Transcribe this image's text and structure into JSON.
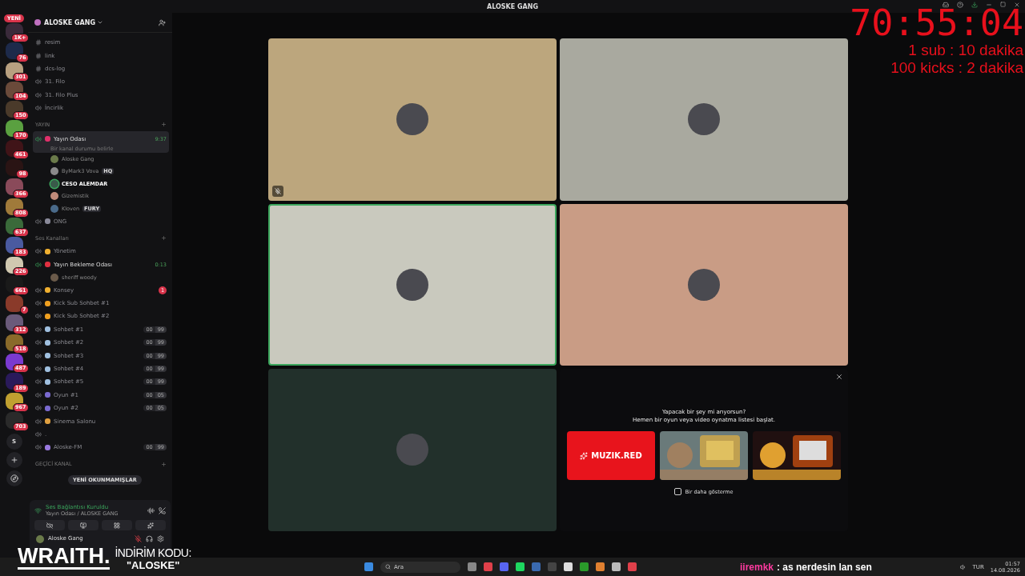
{
  "window": {
    "title": "ALOSKE GANG"
  },
  "servers": {
    "new_label": "YENİ",
    "items": [
      {
        "badge": "1K+",
        "color": "#3a2a3a"
      },
      {
        "badge": "76",
        "color": "#1d2a4a"
      },
      {
        "badge": "301",
        "color": "#b8a080"
      },
      {
        "badge": "104",
        "color": "#6a4a3a"
      },
      {
        "badge": "150",
        "color": "#4a3a2a"
      },
      {
        "badge": "170",
        "color": "#5aa040"
      },
      {
        "badge": "461",
        "color": "#401418"
      },
      {
        "badge": "98",
        "color": "#2a1414"
      },
      {
        "badge": "366",
        "color": "#8a4a5a"
      },
      {
        "badge": "808",
        "color": "#a07a3a"
      },
      {
        "badge": "637",
        "color": "#3a6a3a"
      },
      {
        "badge": "183",
        "color": "#4a5aa0"
      },
      {
        "badge": "226",
        "color": "#d0c8b0"
      },
      {
        "badge": "661",
        "color": "#1a1a1a"
      },
      {
        "badge": "7",
        "color": "#8a3a2a"
      },
      {
        "badge": "312",
        "color": "#6a5a7a"
      },
      {
        "badge": "518",
        "color": "#8a6a2a"
      },
      {
        "badge": "487",
        "color": "#7a3ad0"
      },
      {
        "badge": "189",
        "color": "#2a1a5a"
      },
      {
        "badge": "967",
        "color": "#c0a030"
      },
      {
        "badge": "703",
        "color": "#2a2a2a"
      }
    ],
    "letter": "S"
  },
  "guild": {
    "name": "ALOSKE GANG"
  },
  "channels": [
    {
      "kind": "text",
      "name": "resim"
    },
    {
      "kind": "text",
      "name": "link"
    },
    {
      "kind": "text",
      "name": "dcs-log"
    },
    {
      "kind": "voice",
      "name": "31. Filo"
    },
    {
      "kind": "voice",
      "name": "31. Filo Plus"
    },
    {
      "kind": "voice",
      "name": "İncirlik"
    },
    {
      "kind": "category",
      "name": "YAYIN"
    },
    {
      "kind": "voice",
      "name": "Yayın Odası",
      "color": "#e0306a",
      "connected": true,
      "selected": true,
      "time": "9:37",
      "status": "Bir kanal durumu belirle"
    },
    {
      "kind": "member",
      "name": "Aloske Gang",
      "speaking": false,
      "color": "#6a7a4a"
    },
    {
      "kind": "member",
      "name": "ByMark3 Vova",
      "tag": "HQ",
      "speaking": false,
      "color": "#8a8a8a"
    },
    {
      "kind": "member",
      "name": "CESO ALEMDAR",
      "speaking": true,
      "color": "#3a5a4a"
    },
    {
      "kind": "member",
      "name": "Gizemistik",
      "speaking": false,
      "color": "#c08a7a"
    },
    {
      "kind": "member",
      "name": "Kloven",
      "tag": "FURY",
      "speaking": false,
      "color": "#4a6a8a"
    },
    {
      "kind": "voice",
      "name": "ONG",
      "color": "#8a8a9a"
    },
    {
      "kind": "category",
      "name": "Ses Kanalları"
    },
    {
      "kind": "voice",
      "name": "Yönetim",
      "color": "#f0b030"
    },
    {
      "kind": "voice",
      "name": "Yayın Bekleme Odası",
      "color": "#e03040",
      "connected": true,
      "selected": false,
      "time": "0:13"
    },
    {
      "kind": "member",
      "name": "sheriff woody",
      "speaking": false,
      "color": "#6a5a4a"
    },
    {
      "kind": "voice",
      "name": "Konsey",
      "color": "#f0b030",
      "mentions": "1"
    },
    {
      "kind": "voice",
      "name": "Kick Sub Sohbet #1",
      "color": "#f0a020"
    },
    {
      "kind": "voice",
      "name": "Kick Sub Sohbet #2",
      "color": "#f0a020"
    },
    {
      "kind": "voice",
      "name": "Sohbet #1",
      "color": "#a0c0e0",
      "users": "00",
      "limit": "99"
    },
    {
      "kind": "voice",
      "name": "Sohbet #2",
      "color": "#a0c0e0",
      "users": "00",
      "limit": "99"
    },
    {
      "kind": "voice",
      "name": "Sohbet #3",
      "color": "#a0c0e0",
      "users": "00",
      "limit": "99"
    },
    {
      "kind": "voice",
      "name": "Sohbet #4",
      "color": "#a0c0e0",
      "users": "00",
      "limit": "99"
    },
    {
      "kind": "voice",
      "name": "Sohbet #5",
      "color": "#a0c0e0",
      "users": "00",
      "limit": "99"
    },
    {
      "kind": "voice",
      "name": "Oyun #1",
      "color": "#7a6ad0",
      "users": "00",
      "limit": "05"
    },
    {
      "kind": "voice",
      "name": "Oyun #2",
      "color": "#7a6ad0",
      "users": "00",
      "limit": "05"
    },
    {
      "kind": "voice",
      "name": "Sinema Salonu",
      "color": "#e0a040"
    },
    {
      "kind": "voice",
      "name": "."
    },
    {
      "kind": "voice",
      "name": "Aloske-FM",
      "color": "#9a7ae0",
      "users": "00",
      "limit": "99"
    },
    {
      "kind": "category",
      "name": "GEÇİCİ KANAL"
    }
  ],
  "unread_pill": "YENİ OKUNMAMIŞLAR",
  "voice_panel": {
    "title": "Ses Bağlantısı Kuruldu",
    "location": "Yayın Odası / ALOSKE GANG"
  },
  "user": {
    "name": "Aloske Gang",
    "muted": true
  },
  "tiles": [
    {
      "kind": "video",
      "color": "#bca67d",
      "muted": true,
      "speaking": false
    },
    {
      "kind": "video",
      "color": "#a9a99f",
      "muted": false,
      "speaking": false
    },
    {
      "kind": "video",
      "color": "#c9c9be",
      "muted": false,
      "speaking": true
    },
    {
      "kind": "video",
      "color": "#c99c85",
      "muted": false,
      "speaking": false
    },
    {
      "kind": "video",
      "color": "#22302b",
      "muted": false,
      "speaking": false
    },
    {
      "kind": "activity",
      "line1": "Yapacak bir şey mi arıyorsun?",
      "line2": "Hemen bir oyun veya video oynatma listesi başlat.",
      "cards": [
        {
          "kind": "brand",
          "label": "MUZIK.RED"
        },
        {
          "kind": "picture"
        },
        {
          "kind": "picture"
        }
      ],
      "checkbox": {
        "label": "Bir daha gösterme",
        "checked": false
      }
    }
  ],
  "overlay": {
    "timer": "70:55:04",
    "lines": [
      "1 sub : 10 dakika",
      "100 kicks : 2 dakika"
    ],
    "ad_brand": "WRAITH.",
    "ad_line1": "İNDİRİM KODU:",
    "ad_line2": "\"ALOSKE\"",
    "chat_user": "iiremkk",
    "chat_text": ": as nerdesin lan sen"
  },
  "taskbar": {
    "search": "Ara",
    "language": "TUR",
    "time": "01:57",
    "date": "14.08.2026"
  }
}
